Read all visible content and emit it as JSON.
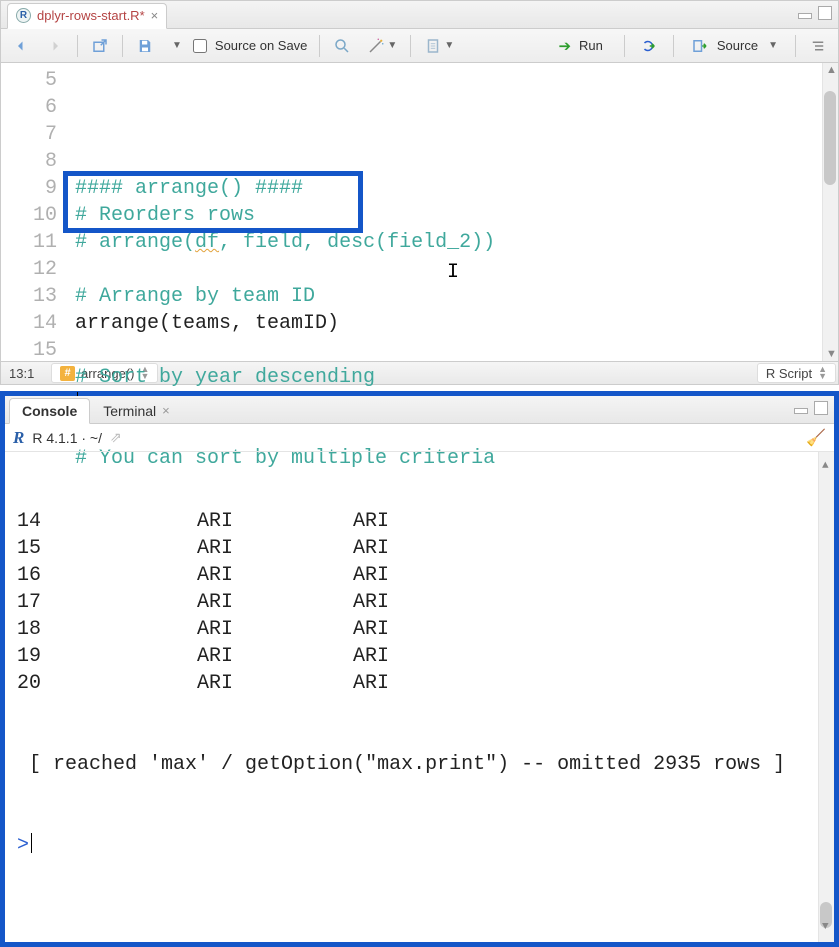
{
  "editor": {
    "file_tab": {
      "name": "dplyr-rows-start.R*",
      "icon": "r"
    },
    "toolbar": {
      "source_on_save_label": "Source on Save",
      "run_label": "Run",
      "source_label": "Source"
    },
    "lines": [
      {
        "n": 5,
        "kind": "comment",
        "text": "#### arrange() ####"
      },
      {
        "n": 6,
        "kind": "comment",
        "text": "# Reorders rows"
      },
      {
        "n": 7,
        "kind": "comment-arrange-ex"
      },
      {
        "n": 8,
        "kind": "blank",
        "text": ""
      },
      {
        "n": 9,
        "kind": "comment",
        "text": "# Arrange by team ID"
      },
      {
        "n": 10,
        "kind": "code",
        "text": "arrange(teams, teamID)"
      },
      {
        "n": 11,
        "kind": "blank",
        "text": ""
      },
      {
        "n": 12,
        "kind": "comment",
        "text": "# Sort by year descending"
      },
      {
        "n": 13,
        "kind": "cursor",
        "text": ""
      },
      {
        "n": 14,
        "kind": "blank",
        "text": ""
      },
      {
        "n": 15,
        "kind": "comment",
        "text": "# You can sort by multiple criteria"
      }
    ],
    "line7_parts": {
      "pre": "# arrange(",
      "wavy": "df",
      "post": ", field, desc(field_2))"
    },
    "status": {
      "cursor_pos": "13:1",
      "crumb": "arrange()",
      "language": "R Script"
    }
  },
  "console": {
    "tabs": [
      {
        "label": "Console",
        "active": true,
        "closable": false
      },
      {
        "label": "Terminal",
        "active": false,
        "closable": true
      }
    ],
    "version_line": "R 4.1.1 · ~/",
    "rows": [
      {
        "n": "14",
        "c1": "ARI",
        "c2": "ARI"
      },
      {
        "n": "15",
        "c1": "ARI",
        "c2": "ARI"
      },
      {
        "n": "16",
        "c1": "ARI",
        "c2": "ARI"
      },
      {
        "n": "17",
        "c1": "ARI",
        "c2": "ARI"
      },
      {
        "n": "18",
        "c1": "ARI",
        "c2": "ARI"
      },
      {
        "n": "19",
        "c1": "ARI",
        "c2": "ARI"
      },
      {
        "n": "20",
        "c1": "ARI",
        "c2": "ARI"
      }
    ],
    "footer_line": " [ reached 'max' / getOption(\"max.print\") -- omitted 2935 rows ]",
    "prompt": ">"
  }
}
